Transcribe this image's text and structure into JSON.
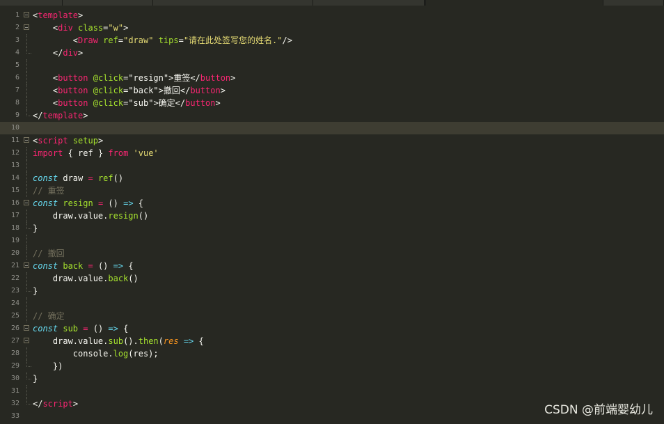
{
  "editor": {
    "lines": [
      {
        "n": "1",
        "fold": "open",
        "cur": false,
        "tokens": [
          [
            "p",
            "<"
          ],
          [
            "k",
            "template"
          ],
          [
            "p",
            ">"
          ]
        ]
      },
      {
        "n": "2",
        "fold": "open",
        "cur": false,
        "tokens": [
          [
            "p",
            "    <"
          ],
          [
            "k",
            "div"
          ],
          [
            "p",
            " "
          ],
          [
            "a",
            "class"
          ],
          [
            "p",
            "="
          ],
          [
            "s",
            "\"w\""
          ],
          [
            "p",
            ">"
          ]
        ]
      },
      {
        "n": "3",
        "fold": "line",
        "cur": false,
        "tokens": [
          [
            "p",
            "        <"
          ],
          [
            "k",
            "Draw"
          ],
          [
            "p",
            " "
          ],
          [
            "a",
            "ref"
          ],
          [
            "p",
            "="
          ],
          [
            "s",
            "\"draw\""
          ],
          [
            "p",
            " "
          ],
          [
            "a",
            "tips"
          ],
          [
            "p",
            "="
          ],
          [
            "s",
            "\"请在此处签写您的姓名.\""
          ],
          [
            "p",
            "/>"
          ]
        ]
      },
      {
        "n": "4",
        "fold": "end",
        "cur": false,
        "tokens": [
          [
            "p",
            "    </"
          ],
          [
            "k",
            "div"
          ],
          [
            "p",
            ">"
          ]
        ]
      },
      {
        "n": "5",
        "fold": "line",
        "cur": false,
        "tokens": []
      },
      {
        "n": "6",
        "fold": "line",
        "cur": false,
        "tokens": [
          [
            "p",
            "    <"
          ],
          [
            "k",
            "button"
          ],
          [
            "p",
            " "
          ],
          [
            "a",
            "@click"
          ],
          [
            "p",
            "="
          ],
          [
            "p",
            "\"resign\""
          ],
          [
            "p",
            ">重签</"
          ],
          [
            "k",
            "button"
          ],
          [
            "p",
            ">"
          ]
        ]
      },
      {
        "n": "7",
        "fold": "line",
        "cur": false,
        "tokens": [
          [
            "p",
            "    <"
          ],
          [
            "k",
            "button"
          ],
          [
            "p",
            " "
          ],
          [
            "a",
            "@click"
          ],
          [
            "p",
            "="
          ],
          [
            "p",
            "\"back\""
          ],
          [
            "p",
            ">撤回</"
          ],
          [
            "k",
            "button"
          ],
          [
            "p",
            ">"
          ]
        ]
      },
      {
        "n": "8",
        "fold": "line",
        "cur": false,
        "tokens": [
          [
            "p",
            "    <"
          ],
          [
            "k",
            "button"
          ],
          [
            "p",
            " "
          ],
          [
            "a",
            "@click"
          ],
          [
            "p",
            "="
          ],
          [
            "p",
            "\"sub\""
          ],
          [
            "p",
            ">确定</"
          ],
          [
            "k",
            "button"
          ],
          [
            "p",
            ">"
          ]
        ]
      },
      {
        "n": "9",
        "fold": "end",
        "cur": false,
        "tokens": [
          [
            "p",
            "</"
          ],
          [
            "k",
            "template"
          ],
          [
            "p",
            ">"
          ]
        ]
      },
      {
        "n": "10",
        "fold": "none",
        "cur": true,
        "tokens": []
      },
      {
        "n": "11",
        "fold": "open",
        "cur": false,
        "tokens": [
          [
            "p",
            "<"
          ],
          [
            "k",
            "script"
          ],
          [
            "p",
            " "
          ],
          [
            "a",
            "setup"
          ],
          [
            "p",
            ">"
          ]
        ]
      },
      {
        "n": "12",
        "fold": "line",
        "cur": false,
        "tokens": [
          [
            "k",
            "import"
          ],
          [
            "p",
            " { ref } "
          ],
          [
            "k",
            "from"
          ],
          [
            "p",
            " "
          ],
          [
            "s",
            "'vue'"
          ]
        ]
      },
      {
        "n": "13",
        "fold": "line",
        "cur": false,
        "tokens": []
      },
      {
        "n": "14",
        "fold": "line",
        "cur": false,
        "tokens": [
          [
            "st",
            "const"
          ],
          [
            "p",
            " draw "
          ],
          [
            "op",
            "="
          ],
          [
            "p",
            " "
          ],
          [
            "f",
            "ref"
          ],
          [
            "p",
            "()"
          ]
        ]
      },
      {
        "n": "15",
        "fold": "line",
        "cur": false,
        "tokens": [
          [
            "c",
            "// 重签"
          ]
        ]
      },
      {
        "n": "16",
        "fold": "open",
        "cur": false,
        "tokens": [
          [
            "st",
            "const"
          ],
          [
            "p",
            " "
          ],
          [
            "f",
            "resign"
          ],
          [
            "p",
            " "
          ],
          [
            "op",
            "="
          ],
          [
            "p",
            " () "
          ],
          [
            "st",
            "=>"
          ],
          [
            "p",
            " {"
          ]
        ]
      },
      {
        "n": "17",
        "fold": "line",
        "cur": false,
        "tokens": [
          [
            "p",
            "    draw.value."
          ],
          [
            "f",
            "resign"
          ],
          [
            "p",
            "()"
          ]
        ]
      },
      {
        "n": "18",
        "fold": "end",
        "cur": false,
        "tokens": [
          [
            "p",
            "}"
          ]
        ]
      },
      {
        "n": "19",
        "fold": "line",
        "cur": false,
        "tokens": []
      },
      {
        "n": "20",
        "fold": "line",
        "cur": false,
        "tokens": [
          [
            "c",
            "// 撤回"
          ]
        ]
      },
      {
        "n": "21",
        "fold": "open",
        "cur": false,
        "tokens": [
          [
            "st",
            "const"
          ],
          [
            "p",
            " "
          ],
          [
            "f",
            "back"
          ],
          [
            "p",
            " "
          ],
          [
            "op",
            "="
          ],
          [
            "p",
            " () "
          ],
          [
            "st",
            "=>"
          ],
          [
            "p",
            " {"
          ]
        ]
      },
      {
        "n": "22",
        "fold": "line",
        "cur": false,
        "tokens": [
          [
            "p",
            "    draw.value."
          ],
          [
            "f",
            "back"
          ],
          [
            "p",
            "()"
          ]
        ]
      },
      {
        "n": "23",
        "fold": "end",
        "cur": false,
        "tokens": [
          [
            "p",
            "}"
          ]
        ]
      },
      {
        "n": "24",
        "fold": "line",
        "cur": false,
        "tokens": []
      },
      {
        "n": "25",
        "fold": "line",
        "cur": false,
        "tokens": [
          [
            "c",
            "// 确定"
          ]
        ]
      },
      {
        "n": "26",
        "fold": "open",
        "cur": false,
        "tokens": [
          [
            "st",
            "const"
          ],
          [
            "p",
            " "
          ],
          [
            "f",
            "sub"
          ],
          [
            "p",
            " "
          ],
          [
            "op",
            "="
          ],
          [
            "p",
            " () "
          ],
          [
            "st",
            "=>"
          ],
          [
            "p",
            " {"
          ]
        ]
      },
      {
        "n": "27",
        "fold": "open",
        "cur": false,
        "tokens": [
          [
            "p",
            "    draw.value."
          ],
          [
            "f",
            "sub"
          ],
          [
            "p",
            "()."
          ],
          [
            "f",
            "then"
          ],
          [
            "p",
            "("
          ],
          [
            "par",
            "res"
          ],
          [
            "p",
            " "
          ],
          [
            "st",
            "=>"
          ],
          [
            "p",
            " {"
          ]
        ]
      },
      {
        "n": "28",
        "fold": "line",
        "cur": false,
        "tokens": [
          [
            "p",
            "        console."
          ],
          [
            "f",
            "log"
          ],
          [
            "p",
            "(res);"
          ]
        ]
      },
      {
        "n": "29",
        "fold": "end",
        "cur": false,
        "tokens": [
          [
            "p",
            "    })"
          ]
        ]
      },
      {
        "n": "30",
        "fold": "end",
        "cur": false,
        "tokens": [
          [
            "p",
            "}"
          ]
        ]
      },
      {
        "n": "31",
        "fold": "line",
        "cur": false,
        "tokens": []
      },
      {
        "n": "32",
        "fold": "end",
        "cur": false,
        "tokens": [
          [
            "p",
            "</"
          ],
          [
            "k",
            "script"
          ],
          [
            "p",
            ">"
          ]
        ]
      },
      {
        "n": "33",
        "fold": "none",
        "cur": false,
        "tokens": []
      }
    ]
  },
  "watermark": "CSDN @前端婴幼儿"
}
